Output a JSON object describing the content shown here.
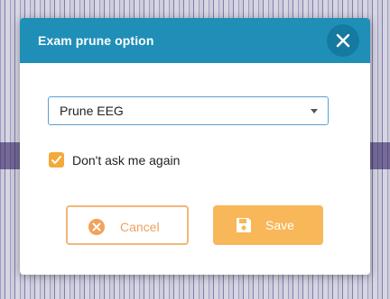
{
  "dialog": {
    "title": "Exam prune option",
    "close_icon": "close-icon"
  },
  "prune_select": {
    "value": "Prune EEG",
    "icon": "caret-down-icon"
  },
  "dont_ask_checkbox": {
    "checked": true,
    "label": "Don't ask me again"
  },
  "buttons": {
    "cancel": {
      "label": "Cancel",
      "icon": "x-circle-icon"
    },
    "save": {
      "label": "Save",
      "icon": "floppy-disk-icon"
    }
  },
  "colors": {
    "header": "#1f8fb8",
    "accent_orange": "#f4a93b",
    "cancel_border": "#f2b678",
    "save_bg": "#f8b758",
    "select_border": "#5b9fd3"
  }
}
